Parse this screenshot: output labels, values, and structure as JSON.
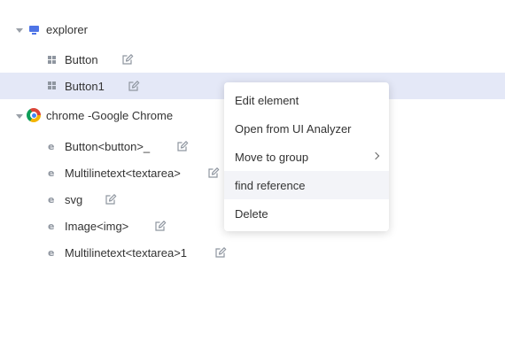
{
  "tree": {
    "explorer": {
      "label": "explorer",
      "children": [
        {
          "label": "Button"
        },
        {
          "label": "Button1"
        }
      ]
    },
    "chrome": {
      "label": "chrome -Google Chrome",
      "children": [
        {
          "label": "Button<button>_"
        },
        {
          "label": "Multilinetext<textarea>"
        },
        {
          "label": "svg"
        },
        {
          "label": "Image<img>"
        },
        {
          "label": "Multilinetext<textarea>1"
        }
      ]
    }
  },
  "context_menu": {
    "items": [
      {
        "label": "Edit element"
      },
      {
        "label": "Open from UI Analyzer"
      },
      {
        "label": "Move to group"
      },
      {
        "label": "find reference"
      },
      {
        "label": "Delete"
      }
    ]
  },
  "colors": {
    "selected_row_bg": "#e4e8f7",
    "accent": "#4e74e6",
    "icon_gray": "#8f96a0"
  },
  "icons": {
    "explorer": "monitor-icon",
    "chrome": "chrome-icon",
    "native_element": "windows-icon",
    "web_element": "ie-icon",
    "edit": "edit-icon"
  }
}
